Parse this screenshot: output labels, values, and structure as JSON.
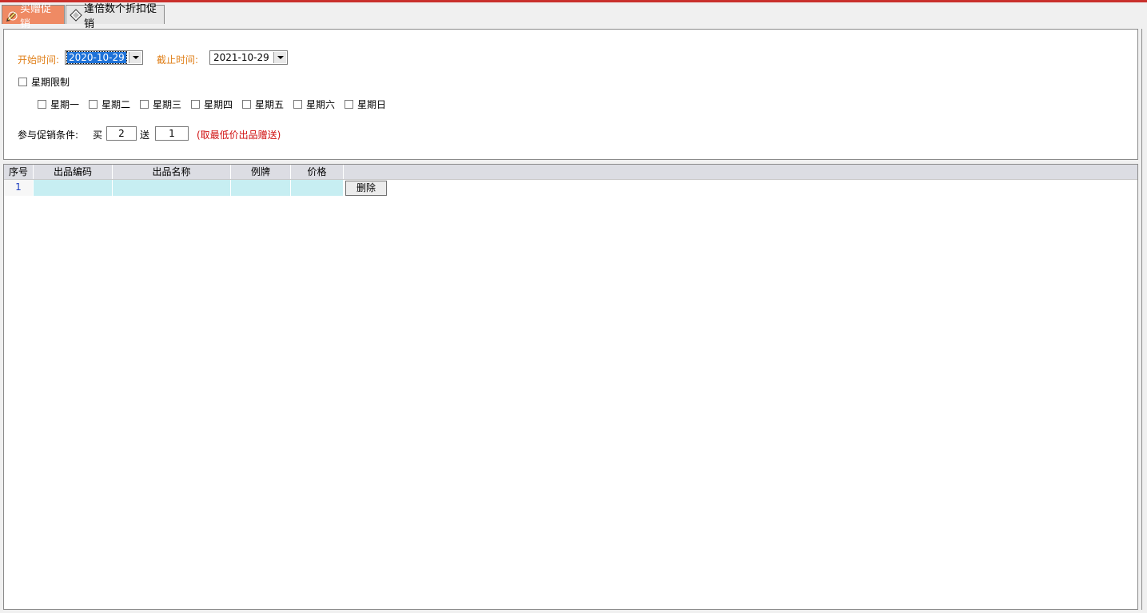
{
  "tabs": [
    {
      "label": "买赠促销",
      "icon": "pencil-icon",
      "active": true
    },
    {
      "label": "逢倍数个折扣促销",
      "icon": "tag-icon",
      "active": false
    }
  ],
  "form": {
    "start_label": "开始时间:",
    "start_value": "2020-10-29",
    "end_label": "截止时间:",
    "end_value": "2021-10-29",
    "weekday_limit_label": "星期限制",
    "weekdays": [
      "星期一",
      "星期二",
      "星期三",
      "星期四",
      "星期五",
      "星期六",
      "星期日"
    ],
    "condition_label": "参与促销条件:",
    "buy_label": "买",
    "buy_value": "2",
    "give_label": "送",
    "give_value": "1",
    "note": "(取最低价出品赠送)"
  },
  "table": {
    "columns": [
      "序号",
      "出品编码",
      "出品名称",
      "例牌",
      "价格"
    ],
    "rows": [
      {
        "index": "1",
        "code": "",
        "name": "",
        "portion": "",
        "price": "",
        "action": "删除"
      }
    ]
  },
  "colors": {
    "accent_tab": "#ef8a64",
    "selection": "#1e72d8",
    "cell": "#c7eef2",
    "label_orange": "#e0801a",
    "note_red": "#d01010"
  }
}
